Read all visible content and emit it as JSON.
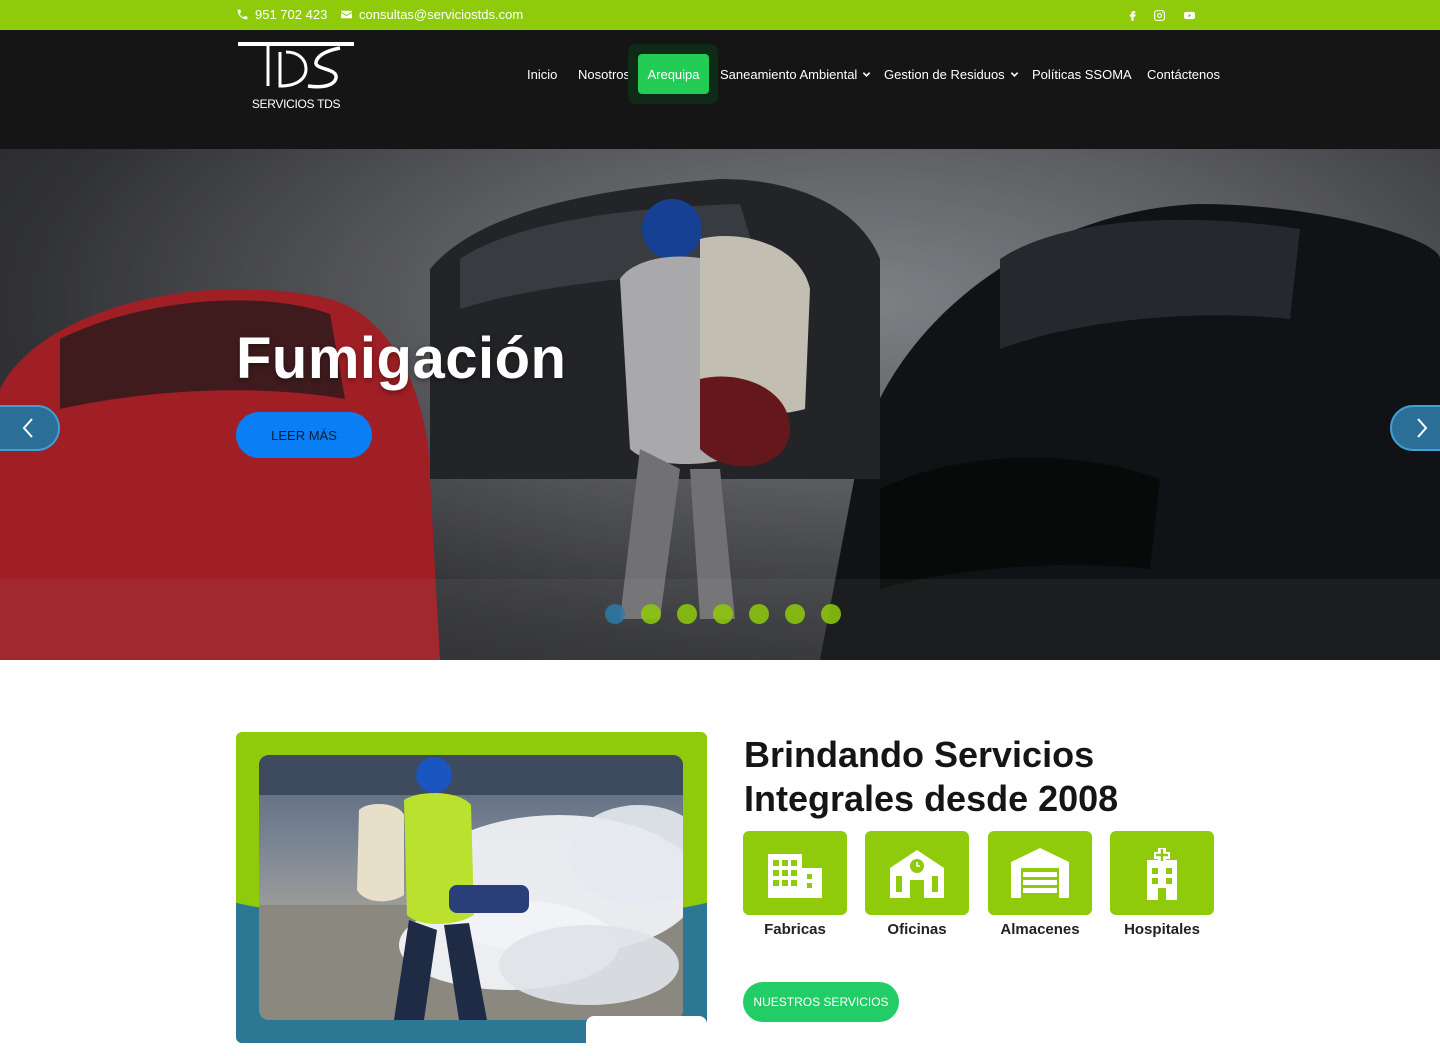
{
  "topbar": {
    "phone": "951 702 423",
    "email": "consultas@serviciostds.com",
    "social": [
      "facebook-icon",
      "instagram-icon",
      "youtube-icon"
    ]
  },
  "header": {
    "logo_text": "SERVICIOS TDS",
    "nav": {
      "inicio": "Inicio",
      "nosotros": "Nosotros",
      "arequipa": "Arequipa",
      "saneamiento": "Saneamiento Ambiental",
      "residuos": "Gestion de Residuos",
      "politicas": "Políticas SSOMA",
      "contacto": "Contáctenos"
    },
    "active_nav": "Arequipa"
  },
  "hero": {
    "title": "Fumigación",
    "button": "LEER MÁS",
    "slide_count": 7,
    "active_slide": 1
  },
  "feature": {
    "heading": "Brindando Servicios Integrales desde 2008",
    "services": {
      "fabricas": "Fabricas",
      "oficinas": "Oficinas",
      "almacenes": "Almacenes",
      "hospitales": "Hospitales"
    },
    "cta": "NUESTROS SERVICIOS"
  },
  "colors": {
    "brand_green": "#8fcb0a",
    "header_black": "#151515",
    "active_green": "#22cc55",
    "hero_button_blue": "#0a7ff5",
    "slider_blue": "#2b7794"
  }
}
